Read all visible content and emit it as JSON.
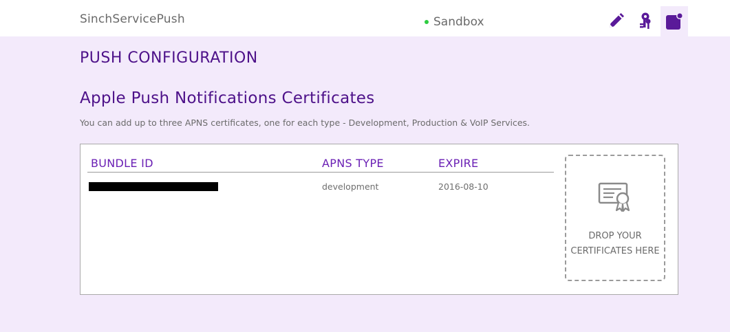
{
  "header": {
    "app_name": "SinchServicePush",
    "environment": "Sandbox",
    "environment_status_color": "#2ecc40",
    "icons": [
      "pencil-icon",
      "keys-icon",
      "push-notification-icon"
    ]
  },
  "page": {
    "section_title": "PUSH CONFIGURATION",
    "subsection_title": "Apple Push Notifications Certificates",
    "description": "You can add up to three APNS certificates, one for each type - Development, Production & VoIP Services."
  },
  "table": {
    "columns": [
      "BUNDLE ID",
      "APNS TYPE",
      "EXPIRE"
    ],
    "rows": [
      {
        "bundle_id": "",
        "apns_type": "development",
        "expire": "2016-08-10"
      }
    ]
  },
  "dropzone": {
    "line1": "DROP YOUR",
    "line2": "CERTIFICATES HERE",
    "icon": "certificate-icon"
  },
  "colors": {
    "accent": "#4d1189",
    "background": "#f3eafb"
  }
}
